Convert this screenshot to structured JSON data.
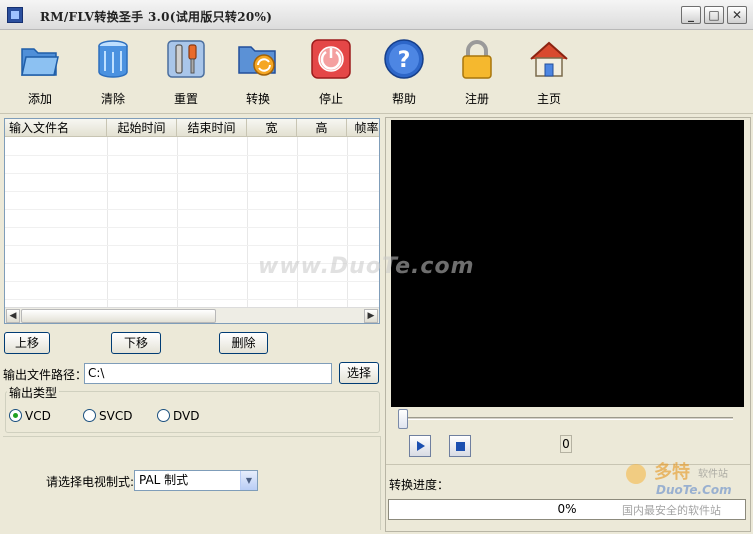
{
  "window": {
    "title": "RM/FLV转换圣手 3.0(试用版只转20%)",
    "minimize_glyph": "_",
    "maximize_glyph": "□",
    "close_glyph": "✕"
  },
  "toolbar": {
    "items": [
      {
        "label": "添加",
        "icon": "folder-icon"
      },
      {
        "label": "清除",
        "icon": "trash-icon"
      },
      {
        "label": "重置",
        "icon": "tools-icon"
      },
      {
        "label": "转换",
        "icon": "convert-icon"
      },
      {
        "label": "停止",
        "icon": "power-icon"
      },
      {
        "label": "帮助",
        "icon": "help-icon"
      },
      {
        "label": "注册",
        "icon": "lock-icon"
      },
      {
        "label": "主页",
        "icon": "home-icon"
      }
    ]
  },
  "file_list": {
    "columns": [
      "输入文件名",
      "起始时间",
      "结束时间",
      "宽",
      "高",
      "帧率"
    ],
    "rows": []
  },
  "list_buttons": {
    "up": "上移",
    "down": "下移",
    "delete": "删除"
  },
  "output": {
    "path_label": "输出文件路径：",
    "path_value": "C:\\",
    "browse": "选择",
    "type_label": "输出类型",
    "types": [
      "VCD",
      "SVCD",
      "DVD"
    ],
    "selected_type": "VCD",
    "tv_label": "请选择电视制式:",
    "tv_value": "PAL 制式"
  },
  "player": {
    "counter": "0",
    "progress_label": "转换进度：",
    "progress_text": "0%",
    "progress_value": 0
  },
  "watermark": {
    "main": "www.DuoTe.com",
    "brand": "多特",
    "brand_sub": "软件站",
    "domain": "DuoTe.Com",
    "slogan": "国内最安全的软件站"
  },
  "colors": {
    "video_bg": "#000000",
    "window_bg": "#ece9d8",
    "accent": "#1b4fb0"
  }
}
